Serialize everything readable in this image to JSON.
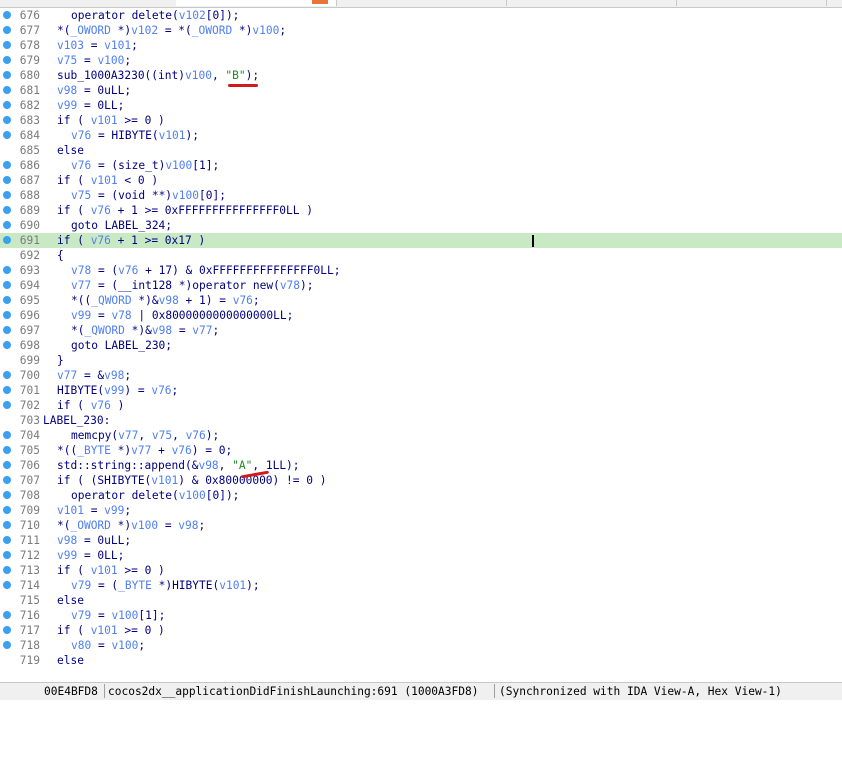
{
  "lines": [
    {
      "n": "676",
      "dot": true,
      "indent": 2,
      "parts": [
        [
          "t",
          "operator delete("
        ],
        [
          "v",
          "v102"
        ],
        [
          "t",
          "[0]);"
        ]
      ]
    },
    {
      "n": "677",
      "dot": true,
      "indent": 1,
      "parts": [
        [
          "t",
          "*("
        ],
        [
          "v",
          "_OWORD"
        ],
        [
          "t",
          " *)"
        ],
        [
          "v",
          "v102"
        ],
        [
          "t",
          " = *("
        ],
        [
          "v",
          "_OWORD"
        ],
        [
          "t",
          " *)"
        ],
        [
          "v",
          "v100"
        ],
        [
          "t",
          ";"
        ]
      ]
    },
    {
      "n": "678",
      "dot": true,
      "indent": 1,
      "parts": [
        [
          "v",
          "v103"
        ],
        [
          "t",
          " = "
        ],
        [
          "v",
          "v101"
        ],
        [
          "t",
          ";"
        ]
      ]
    },
    {
      "n": "679",
      "dot": true,
      "indent": 1,
      "parts": [
        [
          "v",
          "v75"
        ],
        [
          "t",
          " = "
        ],
        [
          "v",
          "v100"
        ],
        [
          "t",
          ";"
        ]
      ]
    },
    {
      "n": "680",
      "dot": true,
      "indent": 1,
      "parts": [
        [
          "t",
          "sub_1000A3230((int)"
        ],
        [
          "v",
          "v100"
        ],
        [
          "t",
          ", "
        ],
        [
          "s",
          "\"B\""
        ],
        [
          "t",
          ");"
        ]
      ]
    },
    {
      "n": "681",
      "dot": true,
      "indent": 1,
      "parts": [
        [
          "v",
          "v98"
        ],
        [
          "t",
          " = 0uLL;"
        ]
      ]
    },
    {
      "n": "682",
      "dot": true,
      "indent": 1,
      "parts": [
        [
          "v",
          "v99"
        ],
        [
          "t",
          " = 0LL;"
        ]
      ]
    },
    {
      "n": "683",
      "dot": true,
      "indent": 1,
      "parts": [
        [
          "t",
          "if ( "
        ],
        [
          "v",
          "v101"
        ],
        [
          "t",
          " >= 0 )"
        ]
      ]
    },
    {
      "n": "684",
      "dot": true,
      "indent": 2,
      "parts": [
        [
          "v",
          "v76"
        ],
        [
          "t",
          " = HIBYTE("
        ],
        [
          "v",
          "v101"
        ],
        [
          "t",
          ");"
        ]
      ]
    },
    {
      "n": "685",
      "dot": false,
      "indent": 1,
      "parts": [
        [
          "t",
          "else"
        ]
      ]
    },
    {
      "n": "686",
      "dot": true,
      "indent": 2,
      "parts": [
        [
          "v",
          "v76"
        ],
        [
          "t",
          " = (size_t)"
        ],
        [
          "v",
          "v100"
        ],
        [
          "t",
          "[1];"
        ]
      ]
    },
    {
      "n": "687",
      "dot": true,
      "indent": 1,
      "parts": [
        [
          "t",
          "if ( "
        ],
        [
          "v",
          "v101"
        ],
        [
          "t",
          " < 0 )"
        ]
      ]
    },
    {
      "n": "688",
      "dot": true,
      "indent": 2,
      "parts": [
        [
          "v",
          "v75"
        ],
        [
          "t",
          " = (void **)"
        ],
        [
          "v",
          "v100"
        ],
        [
          "t",
          "[0];"
        ]
      ]
    },
    {
      "n": "689",
      "dot": true,
      "indent": 1,
      "parts": [
        [
          "t",
          "if ( "
        ],
        [
          "v",
          "v76"
        ],
        [
          "t",
          " + 1 >= 0xFFFFFFFFFFFFFFF0LL )"
        ]
      ]
    },
    {
      "n": "690",
      "dot": true,
      "indent": 2,
      "parts": [
        [
          "t",
          "goto LABEL_324;"
        ]
      ]
    },
    {
      "n": "691",
      "dot": true,
      "indent": 1,
      "hl": true,
      "parts": [
        [
          "t",
          "if ( "
        ],
        [
          "v",
          "v76"
        ],
        [
          "t",
          " + 1 >= 0x17 )"
        ]
      ]
    },
    {
      "n": "692",
      "dot": false,
      "indent": 1,
      "parts": [
        [
          "t",
          "{"
        ]
      ]
    },
    {
      "n": "693",
      "dot": true,
      "indent": 2,
      "parts": [
        [
          "v",
          "v78"
        ],
        [
          "t",
          " = ("
        ],
        [
          "v",
          "v76"
        ],
        [
          "t",
          " + 17) & 0xFFFFFFFFFFFFFFF0LL;"
        ]
      ]
    },
    {
      "n": "694",
      "dot": true,
      "indent": 2,
      "parts": [
        [
          "v",
          "v77"
        ],
        [
          "t",
          " = (__int128 *)operator new("
        ],
        [
          "v",
          "v78"
        ],
        [
          "t",
          ");"
        ]
      ]
    },
    {
      "n": "695",
      "dot": true,
      "indent": 2,
      "parts": [
        [
          "t",
          "*(("
        ],
        [
          "v",
          "_QWORD"
        ],
        [
          "t",
          " *)&"
        ],
        [
          "v",
          "v98"
        ],
        [
          "t",
          " + 1) = "
        ],
        [
          "v",
          "v76"
        ],
        [
          "t",
          ";"
        ]
      ]
    },
    {
      "n": "696",
      "dot": true,
      "indent": 2,
      "parts": [
        [
          "v",
          "v99"
        ],
        [
          "t",
          " = "
        ],
        [
          "v",
          "v78"
        ],
        [
          "t",
          " | 0x8000000000000000LL;"
        ]
      ]
    },
    {
      "n": "697",
      "dot": true,
      "indent": 2,
      "parts": [
        [
          "t",
          "*("
        ],
        [
          "v",
          "_QWORD"
        ],
        [
          "t",
          " *)&"
        ],
        [
          "v",
          "v98"
        ],
        [
          "t",
          " = "
        ],
        [
          "v",
          "v77"
        ],
        [
          "t",
          ";"
        ]
      ]
    },
    {
      "n": "698",
      "dot": true,
      "indent": 2,
      "parts": [
        [
          "t",
          "goto LABEL_230;"
        ]
      ]
    },
    {
      "n": "699",
      "dot": false,
      "indent": 1,
      "parts": [
        [
          "t",
          "}"
        ]
      ]
    },
    {
      "n": "700",
      "dot": true,
      "indent": 1,
      "parts": [
        [
          "v",
          "v77"
        ],
        [
          "t",
          " = &"
        ],
        [
          "v",
          "v98"
        ],
        [
          "t",
          ";"
        ]
      ]
    },
    {
      "n": "701",
      "dot": true,
      "indent": 1,
      "parts": [
        [
          "t",
          "HIBYTE("
        ],
        [
          "v",
          "v99"
        ],
        [
          "t",
          ") = "
        ],
        [
          "v",
          "v76"
        ],
        [
          "t",
          ";"
        ]
      ]
    },
    {
      "n": "702",
      "dot": true,
      "indent": 1,
      "parts": [
        [
          "t",
          "if ( "
        ],
        [
          "v",
          "v76"
        ],
        [
          "t",
          " )"
        ]
      ]
    },
    {
      "n": "703",
      "dot": false,
      "indent": 0,
      "parts": [
        [
          "t",
          "LABEL_230:"
        ]
      ]
    },
    {
      "n": "704",
      "dot": true,
      "indent": 2,
      "parts": [
        [
          "t",
          "memcpy("
        ],
        [
          "v",
          "v77"
        ],
        [
          "t",
          ", "
        ],
        [
          "v",
          "v75"
        ],
        [
          "t",
          ", "
        ],
        [
          "v",
          "v76"
        ],
        [
          "t",
          ");"
        ]
      ]
    },
    {
      "n": "705",
      "dot": true,
      "indent": 1,
      "parts": [
        [
          "t",
          "*(("
        ],
        [
          "v",
          "_BYTE"
        ],
        [
          "t",
          " *)"
        ],
        [
          "v",
          "v77"
        ],
        [
          "t",
          " + "
        ],
        [
          "v",
          "v76"
        ],
        [
          "t",
          ") = 0;"
        ]
      ]
    },
    {
      "n": "706",
      "dot": true,
      "indent": 1,
      "parts": [
        [
          "t",
          "std::string::append(&"
        ],
        [
          "v",
          "v98"
        ],
        [
          "t",
          ", "
        ],
        [
          "s",
          "\"A\""
        ],
        [
          "t",
          ", 1LL);"
        ]
      ]
    },
    {
      "n": "707",
      "dot": true,
      "indent": 1,
      "parts": [
        [
          "t",
          "if ( (SHIBYTE("
        ],
        [
          "v",
          "v101"
        ],
        [
          "t",
          ") & 0x80000000) != 0 )"
        ]
      ]
    },
    {
      "n": "708",
      "dot": true,
      "indent": 2,
      "parts": [
        [
          "t",
          "operator delete("
        ],
        [
          "v",
          "v100"
        ],
        [
          "t",
          "[0]);"
        ]
      ]
    },
    {
      "n": "709",
      "dot": true,
      "indent": 1,
      "parts": [
        [
          "v",
          "v101"
        ],
        [
          "t",
          " = "
        ],
        [
          "v",
          "v99"
        ],
        [
          "t",
          ";"
        ]
      ]
    },
    {
      "n": "710",
      "dot": true,
      "indent": 1,
      "parts": [
        [
          "t",
          "*("
        ],
        [
          "v",
          "_OWORD"
        ],
        [
          "t",
          " *)"
        ],
        [
          "v",
          "v100"
        ],
        [
          "t",
          " = "
        ],
        [
          "v",
          "v98"
        ],
        [
          "t",
          ";"
        ]
      ]
    },
    {
      "n": "711",
      "dot": true,
      "indent": 1,
      "parts": [
        [
          "v",
          "v98"
        ],
        [
          "t",
          " = 0uLL;"
        ]
      ]
    },
    {
      "n": "712",
      "dot": true,
      "indent": 1,
      "parts": [
        [
          "v",
          "v99"
        ],
        [
          "t",
          " = 0LL;"
        ]
      ]
    },
    {
      "n": "713",
      "dot": true,
      "indent": 1,
      "parts": [
        [
          "t",
          "if ( "
        ],
        [
          "v",
          "v101"
        ],
        [
          "t",
          " >= 0 )"
        ]
      ]
    },
    {
      "n": "714",
      "dot": true,
      "indent": 2,
      "parts": [
        [
          "v",
          "v79"
        ],
        [
          "t",
          " = ("
        ],
        [
          "v",
          "_BYTE"
        ],
        [
          "t",
          " *)HIBYTE("
        ],
        [
          "v",
          "v101"
        ],
        [
          "t",
          ");"
        ]
      ]
    },
    {
      "n": "715",
      "dot": false,
      "indent": 1,
      "parts": [
        [
          "t",
          "else"
        ]
      ]
    },
    {
      "n": "716",
      "dot": true,
      "indent": 2,
      "parts": [
        [
          "v",
          "v79"
        ],
        [
          "t",
          " = "
        ],
        [
          "v",
          "v100"
        ],
        [
          "t",
          "[1];"
        ]
      ]
    },
    {
      "n": "717",
      "dot": true,
      "indent": 1,
      "parts": [
        [
          "t",
          "if ( "
        ],
        [
          "v",
          "v101"
        ],
        [
          "t",
          " >= 0 )"
        ]
      ]
    },
    {
      "n": "718",
      "dot": true,
      "indent": 2,
      "parts": [
        [
          "v",
          "v80"
        ],
        [
          "t",
          " = "
        ],
        [
          "v",
          "v100"
        ],
        [
          "t",
          ";"
        ]
      ]
    },
    {
      "n": "719",
      "dot": false,
      "indent": 1,
      "parts": [
        [
          "t",
          "else"
        ]
      ]
    }
  ],
  "status": {
    "address": "00E4BFD8",
    "location": "cocos2dx__applicationDidFinishLaunching:691 (1000A3FD8)",
    "sync": "(Synchronized with IDA View-A, Hex View-1)"
  },
  "colors": {
    "keyword": "#000080",
    "variable": "#4f7ff0",
    "string": "#1d8a1d",
    "highlight": "#c9e9c4",
    "breakpoint_dot": "#3b9ff2",
    "annotation": "#d11a1a"
  },
  "icons": {
    "line_marker": "breakpoint-dot-icon"
  }
}
